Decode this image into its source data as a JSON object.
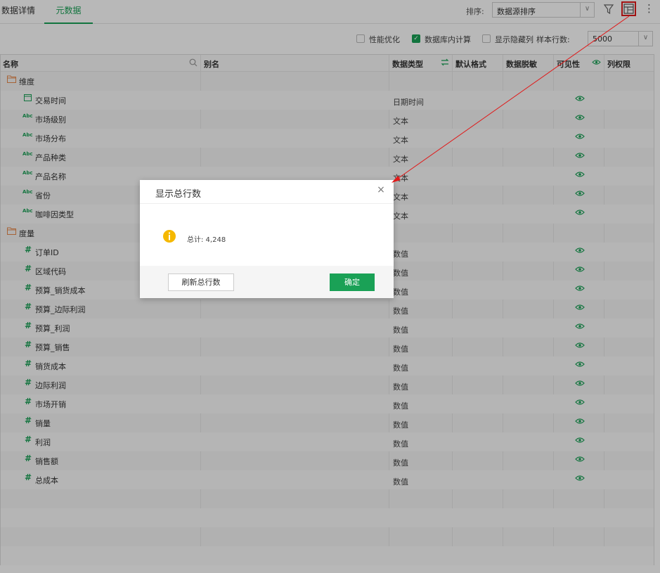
{
  "tabs": [
    "数据详情",
    "元数据"
  ],
  "toolbar": {
    "sort_label": "排序:",
    "sort_value": "数据源排序",
    "filter_icon": "filter-icon",
    "rowcount_icon": "table-rowcount-icon",
    "more_icon": "more-icon"
  },
  "options": {
    "perf": "性能优化",
    "dbcalc": "数据库内计算",
    "show_hidden": "显示隐藏列",
    "sample_label": "样本行数:",
    "sample_value": "5000"
  },
  "columns": {
    "name": "名称",
    "alias": "别名",
    "type": "数据类型",
    "format": "默认格式",
    "mask": "数据脱敏",
    "visible": "可见性",
    "perm": "列权限"
  },
  "groups": {
    "dim": "维度",
    "measure": "度量"
  },
  "dimensions": [
    {
      "name": "交易时间",
      "type": "日期时间",
      "icon": "calendar-icon"
    },
    {
      "name": "市场级别",
      "type": "文本",
      "icon": "abc-icon"
    },
    {
      "name": "市场分布",
      "type": "文本",
      "icon": "abc-icon"
    },
    {
      "name": "产品种类",
      "type": "文本",
      "icon": "abc-icon"
    },
    {
      "name": "产品名称",
      "type": "文本",
      "icon": "abc-icon"
    },
    {
      "name": "省份",
      "type": "文本",
      "icon": "abc-icon"
    },
    {
      "name": "咖啡因类型",
      "type": "文本",
      "icon": "abc-icon"
    }
  ],
  "measures": [
    {
      "name": "订单ID",
      "type": "数值"
    },
    {
      "name": "区域代码",
      "type": "数值"
    },
    {
      "name": "预算_销货成本",
      "type": "数值"
    },
    {
      "name": "预算_边际利润",
      "type": "数值"
    },
    {
      "name": "预算_利润",
      "type": "数值"
    },
    {
      "name": "预算_销售",
      "type": "数值"
    },
    {
      "name": "销货成本",
      "type": "数值"
    },
    {
      "name": "边际利润",
      "type": "数值"
    },
    {
      "name": "市场开销",
      "type": "数值"
    },
    {
      "name": "销量",
      "type": "数值"
    },
    {
      "name": "利润",
      "type": "数值"
    },
    {
      "name": "销售额",
      "type": "数值"
    },
    {
      "name": "总成本",
      "type": "数值"
    }
  ],
  "icons": {
    "abc": "Abc",
    "hash": "#"
  },
  "dialog": {
    "title": "显示总行数",
    "message": "总计: 4,248",
    "refresh_label": "刷新总行数",
    "ok_label": "确定",
    "close_glyph": "×"
  },
  "colors": {
    "accent": "#1aa156",
    "folder": "#e8894b",
    "info": "#f5b800",
    "highlight": "#e01b1b"
  }
}
